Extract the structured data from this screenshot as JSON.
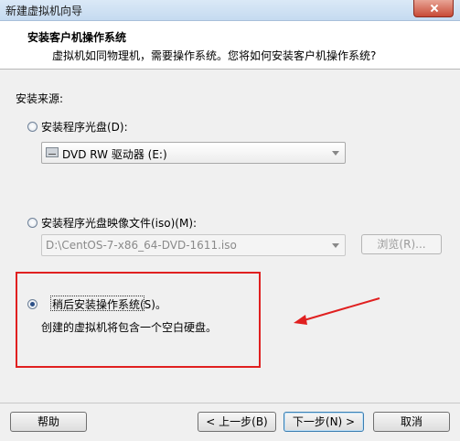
{
  "window": {
    "title": "新建虚拟机向导"
  },
  "header": {
    "title": "安装客户机操作系统",
    "subtitle": "虚拟机如同物理机，需要操作系统。您将如何安装客户机操作系统?"
  },
  "install_source": {
    "label": "安装来源:",
    "options": [
      {
        "label": "安装程序光盘(D):",
        "selected": false
      },
      {
        "label": "安装程序光盘映像文件(iso)(M):",
        "selected": false
      },
      {
        "label": "稍后安装操作系统(S)。",
        "selected": true
      }
    ],
    "drive_select_value": "DVD RW 驱动器 (E:)",
    "iso_path_value": "D:\\CentOS-7-x86_64-DVD-1611.iso",
    "browse_button": "浏览(R)...",
    "later_description": "创建的虚拟机将包含一个空白硬盘。"
  },
  "footer": {
    "help": "帮助",
    "back": "< 上一步(B)",
    "next": "下一步(N) >",
    "cancel": "取消"
  },
  "annotation": {
    "color": "#e02020"
  }
}
